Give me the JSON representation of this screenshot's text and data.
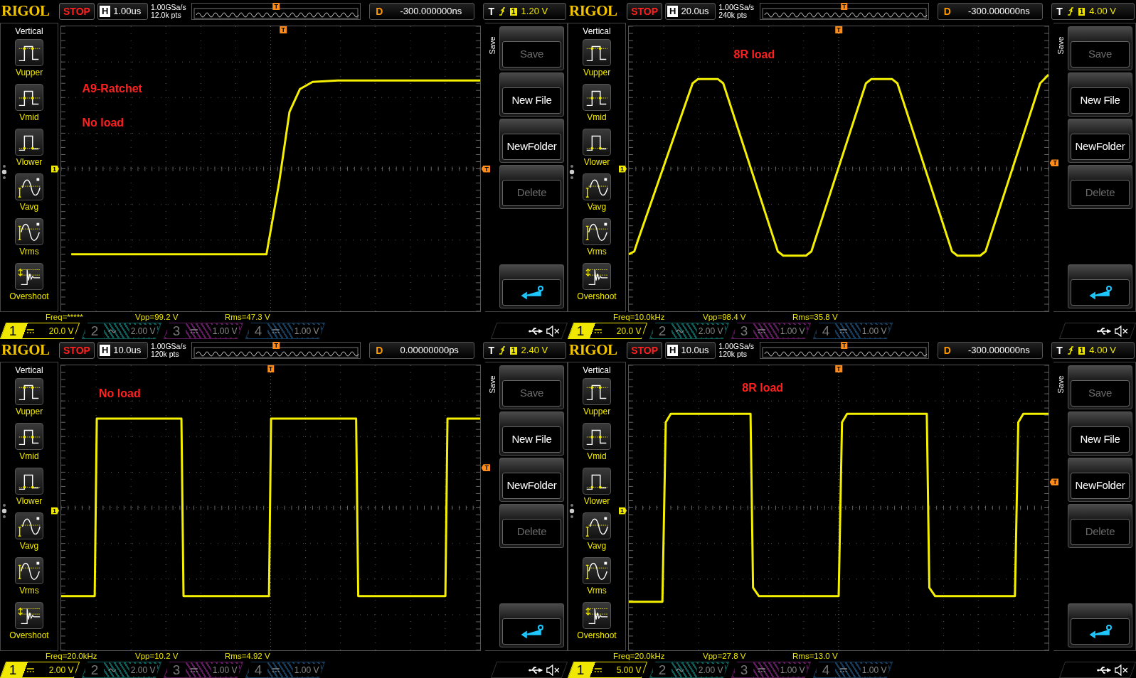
{
  "screens": [
    {
      "header": {
        "brand": "RIGOL",
        "run_state": "STOP",
        "timebase_label": "H",
        "timebase": "1.00us",
        "sample_rate": "1.00GSa/s",
        "memory_depth": "12.0k pts",
        "overview_marker": "T",
        "delay_label": "D",
        "delay": "-300.000000ns",
        "trigger_label": "T",
        "trigger_source": "1",
        "trigger_level": "1.20 V"
      },
      "measure_menu": {
        "title": "Vertical",
        "items": [
          {
            "kind": "vupper",
            "label": "Vupper"
          },
          {
            "kind": "vmid",
            "label": "Vmid"
          },
          {
            "kind": "vlower",
            "label": "Vlower"
          },
          {
            "kind": "vavg",
            "label": "Vavg"
          },
          {
            "kind": "vrms",
            "label": "Vrms"
          },
          {
            "kind": "overshoot",
            "label": "Overshoot"
          }
        ]
      },
      "annotations": [
        "A9-Ratchet",
        "No load"
      ],
      "waveform": {
        "kind": "step"
      },
      "channel_marker": "1",
      "trigger_position_marker": "T",
      "trigger_level_marker": "T",
      "measurements": [
        "Freq=*****",
        "Vpp=99.2 V",
        "Rms=47.3 V"
      ],
      "channels": [
        {
          "number": "1",
          "kind": "dc",
          "scale": "20.0 V",
          "selected": true,
          "color": "#f0e800"
        },
        {
          "number": "2",
          "kind": "ac",
          "scale": "2.00 V",
          "selected": false,
          "color": "#0e5a56"
        },
        {
          "number": "3",
          "kind": "dc",
          "scale": "1.00 V",
          "selected": false,
          "color": "#5a1a5a"
        },
        {
          "number": "4",
          "kind": "dc",
          "scale": "1.00 V",
          "selected": false,
          "color": "#163a5a"
        }
      ],
      "save_menu": {
        "title": "Save",
        "buttons": [
          {
            "kind": "text",
            "label": "Save",
            "disabled": true
          },
          {
            "kind": "text",
            "label": "New File",
            "disabled": false
          },
          {
            "kind": "text",
            "label": "NewFolder",
            "disabled": false
          },
          {
            "kind": "text",
            "label": "Delete",
            "disabled": true
          },
          {
            "kind": "return"
          }
        ]
      }
    },
    {
      "header": {
        "brand": "RIGOL",
        "run_state": "STOP",
        "timebase_label": "H",
        "timebase": "20.0us",
        "sample_rate": "1.00GSa/s",
        "memory_depth": "240k pts",
        "overview_marker": "T",
        "delay_label": "D",
        "delay": "-300.000000ns",
        "trigger_label": "T",
        "trigger_source": "1",
        "trigger_level": "4.00 V"
      },
      "measure_menu": {
        "title": "Vertical",
        "items": [
          {
            "kind": "vupper",
            "label": "Vupper"
          },
          {
            "kind": "vmid",
            "label": "Vmid"
          },
          {
            "kind": "vlower",
            "label": "Vlower"
          },
          {
            "kind": "vavg",
            "label": "Vavg"
          },
          {
            "kind": "vrms",
            "label": "Vrms"
          },
          {
            "kind": "overshoot",
            "label": "Overshoot"
          }
        ]
      },
      "annotations": [
        "8R load"
      ],
      "waveform": {
        "kind": "trapezoid"
      },
      "channel_marker": "1",
      "trigger_position_marker": "T",
      "trigger_level_marker": "T",
      "measurements": [
        "Freq=10.0kHz",
        "Vpp=98.4 V",
        "Rms=35.8 V"
      ],
      "channels": [
        {
          "number": "1",
          "kind": "dc",
          "scale": "20.0 V",
          "selected": true,
          "color": "#f0e800"
        },
        {
          "number": "2",
          "kind": "ac",
          "scale": "2.00 V",
          "selected": false,
          "color": "#0e5a56"
        },
        {
          "number": "3",
          "kind": "dc",
          "scale": "1.00 V",
          "selected": false,
          "color": "#5a1a5a"
        },
        {
          "number": "4",
          "kind": "dc",
          "scale": "1.00 V",
          "selected": false,
          "color": "#163a5a"
        }
      ],
      "save_menu": {
        "title": "Save",
        "buttons": [
          {
            "kind": "text",
            "label": "Save",
            "disabled": true
          },
          {
            "kind": "text",
            "label": "New File",
            "disabled": false
          },
          {
            "kind": "text",
            "label": "NewFolder",
            "disabled": false
          },
          {
            "kind": "text",
            "label": "Delete",
            "disabled": true
          },
          {
            "kind": "return"
          }
        ]
      }
    },
    {
      "header": {
        "brand": "RIGOL",
        "run_state": "STOP",
        "timebase_label": "H",
        "timebase": "10.0us",
        "sample_rate": "1.00GSa/s",
        "memory_depth": "120k pts",
        "overview_marker": "T",
        "delay_label": "D",
        "delay": "0.00000000ps",
        "trigger_label": "T",
        "trigger_source": "1",
        "trigger_level": "2.40 V"
      },
      "measure_menu": {
        "title": "Vertical",
        "items": [
          {
            "kind": "vupper",
            "label": "Vupper"
          },
          {
            "kind": "vmid",
            "label": "Vmid"
          },
          {
            "kind": "vlower",
            "label": "Vlower"
          },
          {
            "kind": "vavg",
            "label": "Vavg"
          },
          {
            "kind": "vrms",
            "label": "Vrms"
          },
          {
            "kind": "overshoot",
            "label": "Overshoot"
          }
        ]
      },
      "annotations": [
        "No load"
      ],
      "waveform": {
        "kind": "square"
      },
      "channel_marker": "1",
      "trigger_position_marker": "T",
      "trigger_level_marker": "T",
      "measurements": [
        "Freq=20.0kHz",
        "Vpp=10.2 V",
        "Rms=4.92 V"
      ],
      "channels": [
        {
          "number": "1",
          "kind": "dc",
          "scale": "2.00 V",
          "selected": true,
          "color": "#f0e800"
        },
        {
          "number": "2",
          "kind": "ac",
          "scale": "2.00 V",
          "selected": false,
          "color": "#0e5a56"
        },
        {
          "number": "3",
          "kind": "dc",
          "scale": "1.00 V",
          "selected": false,
          "color": "#5a1a5a"
        },
        {
          "number": "4",
          "kind": "dc",
          "scale": "1.00 V",
          "selected": false,
          "color": "#163a5a"
        }
      ],
      "save_menu": {
        "title": "Save",
        "buttons": [
          {
            "kind": "text",
            "label": "Save",
            "disabled": true
          },
          {
            "kind": "text",
            "label": "New File",
            "disabled": false
          },
          {
            "kind": "text",
            "label": "NewFolder",
            "disabled": false
          },
          {
            "kind": "text",
            "label": "Delete",
            "disabled": true
          },
          {
            "kind": "return"
          }
        ]
      }
    },
    {
      "header": {
        "brand": "RIGOL",
        "run_state": "STOP",
        "timebase_label": "H",
        "timebase": "10.0us",
        "sample_rate": "1.00GSa/s",
        "memory_depth": "120k pts",
        "overview_marker": "T",
        "delay_label": "D",
        "delay": "-300.000000ns",
        "trigger_label": "T",
        "trigger_source": "1",
        "trigger_level": "4.00 V"
      },
      "measure_menu": {
        "title": "Vertical",
        "items": [
          {
            "kind": "vupper",
            "label": "Vupper"
          },
          {
            "kind": "vmid",
            "label": "Vmid"
          },
          {
            "kind": "vlower",
            "label": "Vlower"
          },
          {
            "kind": "vavg",
            "label": "Vavg"
          },
          {
            "kind": "vrms",
            "label": "Vrms"
          },
          {
            "kind": "overshoot",
            "label": "Overshoot"
          }
        ]
      },
      "annotations": [
        "8R load"
      ],
      "waveform": {
        "kind": "square_rounded"
      },
      "channel_marker": "1",
      "trigger_position_marker": "T",
      "trigger_level_marker": "T",
      "measurements": [
        "Freq=20.0kHz",
        "Vpp=27.8 V",
        "Rms=13.0 V"
      ],
      "channels": [
        {
          "number": "1",
          "kind": "dc",
          "scale": "5.00 V",
          "selected": true,
          "color": "#f0e800"
        },
        {
          "number": "2",
          "kind": "ac",
          "scale": "2.00 V",
          "selected": false,
          "color": "#0e5a56"
        },
        {
          "number": "3",
          "kind": "dc",
          "scale": "1.00 V",
          "selected": false,
          "color": "#5a1a5a"
        },
        {
          "number": "4",
          "kind": "dc",
          "scale": "1.00 V",
          "selected": false,
          "color": "#163a5a"
        }
      ],
      "save_menu": {
        "title": "Save",
        "buttons": [
          {
            "kind": "text",
            "label": "Save",
            "disabled": true
          },
          {
            "kind": "text",
            "label": "New File",
            "disabled": false
          },
          {
            "kind": "text",
            "label": "NewFolder",
            "disabled": false
          },
          {
            "kind": "text",
            "label": "Delete",
            "disabled": true
          },
          {
            "kind": "return"
          }
        ]
      }
    }
  ]
}
